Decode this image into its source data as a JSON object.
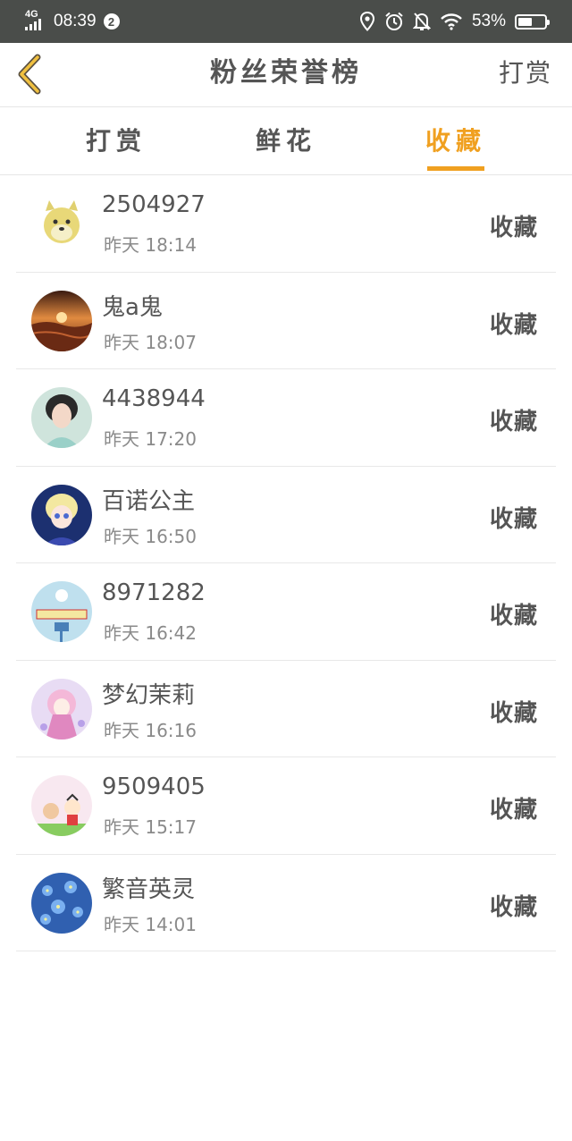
{
  "status_bar": {
    "network": "4G",
    "time": "08:39",
    "notification_count": "2",
    "battery_percent": "53%",
    "battery_level": 0.53,
    "icons": [
      "location-icon",
      "alarm-icon",
      "bell-off-icon",
      "wifi-icon",
      "battery-icon"
    ]
  },
  "nav": {
    "title": "粉丝荣誉榜",
    "right_label": "打赏",
    "back_icon": "back-chevron-icon",
    "accent_color": "#f0a020"
  },
  "tabs": [
    {
      "label": "打赏",
      "active": false
    },
    {
      "label": "鲜花",
      "active": false
    },
    {
      "label": "收藏",
      "active": true
    }
  ],
  "fans": [
    {
      "name": "2504927",
      "time": "昨天 18:14",
      "tag": "收藏",
      "avatar": "shiba-dog-avatar"
    },
    {
      "name": "鬼a鬼",
      "time": "昨天 18:07",
      "tag": "收藏",
      "avatar": "sunset-avatar"
    },
    {
      "name": "4438944",
      "time": "昨天 17:20",
      "tag": "收藏",
      "avatar": "girl-portrait-avatar"
    },
    {
      "name": "百诺公主",
      "time": "昨天 16:50",
      "tag": "收藏",
      "avatar": "anime-girl-avatar"
    },
    {
      "name": "8971282",
      "time": "昨天 16:42",
      "tag": "收藏",
      "avatar": "snowman-sign-avatar"
    },
    {
      "name": "梦幻茉莉",
      "time": "昨天 16:16",
      "tag": "收藏",
      "avatar": "pink-anime-avatar"
    },
    {
      "name": "9509405",
      "time": "昨天 15:17",
      "tag": "收藏",
      "avatar": "cartoon-kids-avatar"
    },
    {
      "name": "繁音英灵",
      "time": "昨天 14:01",
      "tag": "收藏",
      "avatar": "blue-flowers-avatar"
    }
  ]
}
